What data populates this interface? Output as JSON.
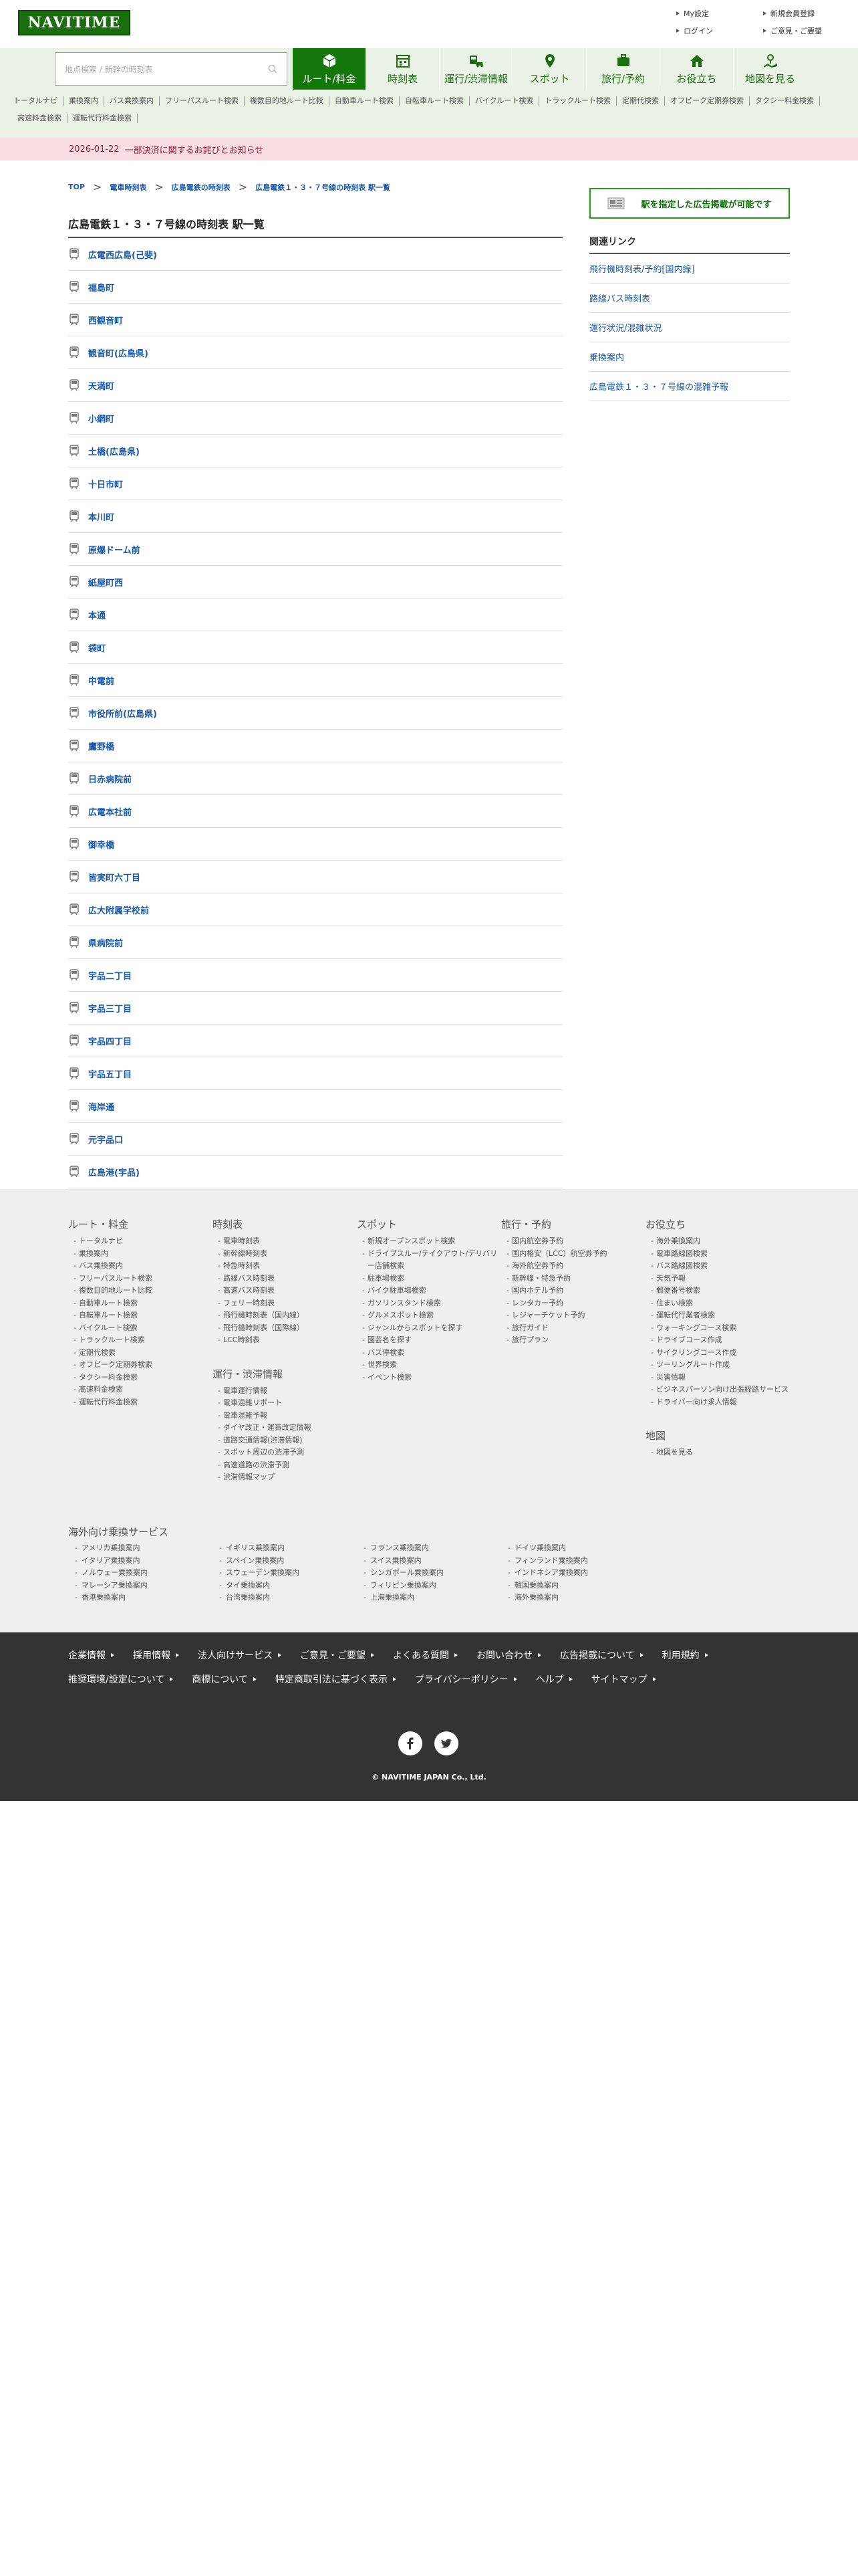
{
  "header": {
    "logo": "NAVITIME",
    "links": [
      "My設定",
      "新規会員登録",
      "ログイン",
      "ご意見・ご要望"
    ]
  },
  "search": {
    "placeholder": "地点検索 / 新幹の時刻表"
  },
  "gnav": [
    {
      "label": "ルート/料金",
      "icon": "cube-icon",
      "active": true
    },
    {
      "label": "時刻表",
      "icon": "calendar-icon"
    },
    {
      "label": "運行/渋滞情報",
      "icon": "train-car-icon"
    },
    {
      "label": "スポット",
      "icon": "pin-icon"
    },
    {
      "label": "旅行/予約",
      "icon": "suitcase-icon"
    },
    {
      "label": "お役立ち",
      "icon": "house-icon"
    },
    {
      "label": "地図を見る",
      "icon": "map-icon"
    }
  ],
  "subnav": [
    "トータルナビ",
    "乗換案内",
    "バス乗換案内",
    "フリーパスルート検索",
    "複数目的地ルート比較",
    "自動車ルート検索",
    "自転車ルート検索",
    "バイクルート検索",
    "トラックルート検索",
    "定期代検索",
    "オフピーク定期券検索",
    "タクシー料金検索",
    "高速料金検索",
    "運転代行料金検索"
  ],
  "notice": {
    "date": "2026-01-22",
    "message": "一部決済に関するお詫びとお知らせ"
  },
  "breadcrumb": [
    "TOP",
    "電車時刻表",
    "広島電鉄の時刻表",
    "広島電鉄１・３・７号線の時刻表 駅一覧"
  ],
  "page_title": "広島電鉄１・３・７号線の時刻表 駅一覧",
  "stations": [
    "広電西広島(己斐)",
    "福島町",
    "西観音町",
    "観音町(広島県)",
    "天満町",
    "小網町",
    "土橋(広島県)",
    "十日市町",
    "本川町",
    "原爆ドーム前",
    "紙屋町西",
    "本通",
    "袋町",
    "中電前",
    "市役所前(広島県)",
    "鷹野橋",
    "日赤病院前",
    "広電本社前",
    "御幸橋",
    "皆実町六丁目",
    "広大附属学校前",
    "県病院前",
    "宇品二丁目",
    "宇品三丁目",
    "宇品四丁目",
    "宇品五丁目",
    "海岸通",
    "元宇品口",
    "広島港(宇品)"
  ],
  "side": {
    "ad_button": "駅を指定した広告掲載が可能です",
    "related_title": "関連リンク",
    "related": [
      "飛行機時刻表/予約[国内線]",
      "路線バス時刻表",
      "運行状況/混雑状況",
      "乗換案内",
      "広島電鉄１・３・７号線の混雑予報"
    ]
  },
  "footer_cols": [
    {
      "title": "ルート・料金",
      "items": [
        "トータルナビ",
        "乗換案内",
        "バス乗換案内",
        "フリーパスルート検索",
        "複数目的地ルート比較",
        "自動車ルート検索",
        "自転車ルート検索",
        "バイクルート検索",
        "トラックルート検索",
        "定期代検索",
        "オフピーク定期券検索",
        "タクシー料金検索",
        "高速料金検索",
        "運転代行料金検索"
      ]
    },
    {
      "title": "時刻表",
      "items": [
        "電車時刻表",
        "新幹線時刻表",
        "特急時刻表",
        "路線バス時刻表",
        "高速バス時刻表",
        "フェリー時刻表",
        "飛行機時刻表（国内線）",
        "飛行機時刻表（国際線）",
        "LCC時刻表"
      ],
      "sub_title": "運行・渋滞情報",
      "sub_items": [
        "電車運行情報",
        "電車混雑リポート",
        "電車混雑予報",
        "ダイヤ改正・運賃改定情報",
        "道路交通情報(渋滞情報)",
        "スポット周辺の渋滞予測",
        "高速道路の渋滞予測",
        "渋滞情報マップ"
      ]
    },
    {
      "title": "スポット",
      "items": [
        "新規オープンスポット検索",
        "ドライブスルー/テイクアウト/デリバリー店舗検索",
        "駐車場検索",
        "バイク駐車場検索",
        "ガソリンスタンド検索",
        "グルメスポット検索",
        "ジャンルからスポットを探す",
        "園芸名を探す",
        "バス停検索",
        "世界検索",
        "イベント検索"
      ]
    },
    {
      "title": "旅行・予約",
      "items": [
        "国内航空券予約",
        "国内格安（LCC）航空券予約",
        "海外航空券予約",
        "新幹線・特急予約",
        "国内ホテル予約",
        "レンタカー予約",
        "レジャーチケット予約",
        "旅行ガイド",
        "旅行プラン"
      ]
    },
    {
      "title": "お役立ち",
      "items": [
        "海外乗換案内",
        "電車路線図検索",
        "バス路線図検索",
        "天気予報",
        "郵便番号検索",
        "住まい検索",
        "運転代行業者検索",
        "ウォーキングコース検索",
        "ドライブコース作成",
        "サイクリングコース作成",
        "ツーリングルート作成",
        "災害情報",
        "ビジネスパーソン向け出張経路サービス",
        "ドライバー向け求人情報"
      ],
      "sub_title": "地図",
      "sub_items": [
        "地図を見る"
      ]
    }
  ],
  "overseas": {
    "title": "海外向け乗換サービス",
    "items": [
      "アメリカ乗換案内",
      "イギリス乗換案内",
      "フランス乗換案内",
      "ドイツ乗換案内",
      "イタリア乗換案内",
      "スペイン乗換案内",
      "スイス乗換案内",
      "フィンランド乗換案内",
      "ノルウェー乗換案内",
      "スウェーデン乗換案内",
      "シンガポール乗換案内",
      "インドネシア乗換案内",
      "マレーシア乗換案内",
      "タイ乗換案内",
      "フィリピン乗換案内",
      "韓国乗換案内",
      "香港乗換案内",
      "台湾乗換案内",
      "上海乗換案内",
      "海外乗換案内"
    ]
  },
  "footer_links": [
    "企業情報",
    "採用情報",
    "法人向けサービス",
    "ご意見・ご要望",
    "よくある質問",
    "お問い合わせ",
    "広告掲載について",
    "利用規約",
    "推奨環境/設定について",
    "商標について",
    "特定商取引法に基づく表示",
    "プライバシーポリシー",
    "ヘルプ",
    "サイトマップ"
  ],
  "social": [
    "facebook-icon",
    "twitter-icon"
  ],
  "copyright": "© NAVITIME JAPAN Co., Ltd.",
  "colors": {
    "brand": "#13770b",
    "link": "#1a5aa8",
    "notice_bg": "#f7dde2",
    "footer_dark": "#333333"
  }
}
